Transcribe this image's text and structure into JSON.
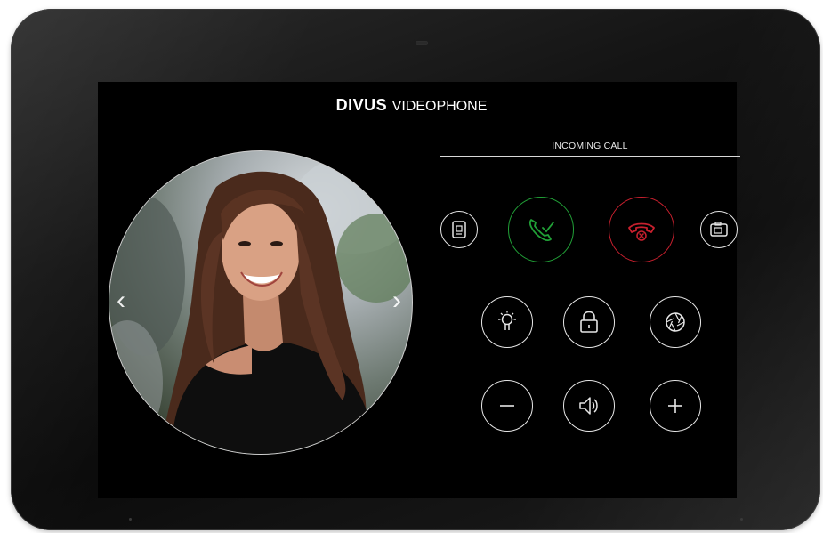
{
  "brand": {
    "bold": "DIVUS",
    "light": "VIDEOPHONE"
  },
  "call": {
    "status": "INCOMING CALL"
  },
  "colors": {
    "accept": "#21a037",
    "reject": "#c8202e",
    "icon": "#e6e6e6",
    "background": "#000000"
  },
  "navigation": {
    "prev_glyph": "‹",
    "next_glyph": "›"
  },
  "controls": {
    "row1": [
      "intercom-panel-icon",
      "accept-call-icon",
      "reject-call-icon",
      "camera-gallery-icon"
    ],
    "row2": [
      "light-icon",
      "door-unlock-icon",
      "camera-shutter-icon"
    ],
    "row3": [
      "volume-down-icon",
      "speaker-icon",
      "volume-up-icon"
    ]
  }
}
